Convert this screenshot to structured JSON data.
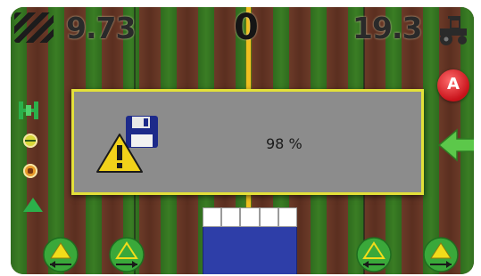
{
  "header": {
    "speed": "9.73",
    "offline_distance": "0",
    "area": "19.3"
  },
  "dialog": {
    "progress_text": "98 %"
  },
  "icons": {
    "top_left": "field-hatch-icon",
    "top_right": "tractor-icon",
    "left": [
      "lightbar-icon",
      "guidance-mode-icon",
      "boom-status-icon",
      "triangle-status-icon"
    ],
    "right": [
      "auto-steer-button",
      "back-arrow-icon"
    ],
    "dialog": [
      "floppy-disk-icon",
      "warning-icon"
    ],
    "bottom": [
      "steer-left-button",
      "shift-left-button",
      "shift-right-button",
      "steer-right-button"
    ]
  },
  "auto_button_label": "A",
  "colors": {
    "guide_line": "#f0c020",
    "dialog_border": "#e3e03a",
    "dialog_bg": "#8c8c8c",
    "boom": "#2e3ea8",
    "auto_button": "#c8121a",
    "green_arrow": "#5cc84a"
  }
}
